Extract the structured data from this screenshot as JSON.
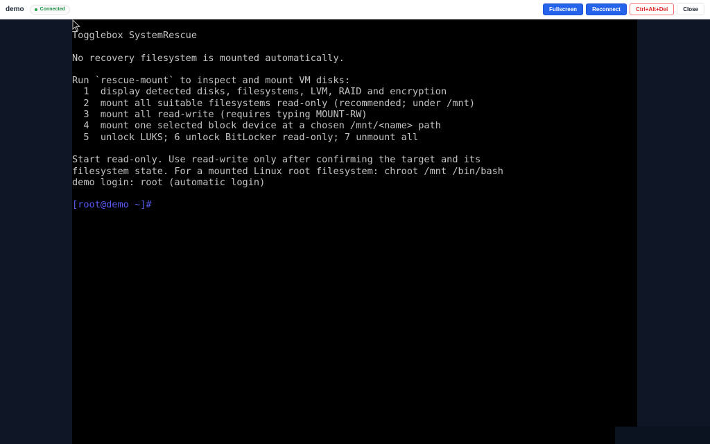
{
  "header": {
    "vm_name": "demo",
    "status": "Connected",
    "buttons": {
      "fullscreen": "Fullscreen",
      "reconnect": "Reconnect",
      "ctrl_alt_del": "Ctrl+Alt+Del",
      "close": "Close"
    }
  },
  "console": {
    "lines": [
      "Togglebox SystemRescue",
      "",
      "No recovery filesystem is mounted automatically.",
      "",
      "Run `rescue-mount` to inspect and mount VM disks:",
      "  1  display detected disks, filesystems, LVM, RAID and encryption",
      "  2  mount all suitable filesystems read-only (recommended; under /mnt)",
      "  3  mount all read-write (requires typing MOUNT-RW)",
      "  4  mount one selected block device at a chosen /mnt/<name> path",
      "  5  unlock LUKS; 6 unlock BitLocker read-only; 7 unmount all",
      "",
      "Start read-only. Use read-write only after confirming the target and its",
      "filesystem state. For a mounted Linux root filesystem: chroot /mnt /bin/bash",
      "demo login: root (automatic login)",
      ""
    ],
    "prompt": "[root@demo ~]#"
  },
  "colors": {
    "accent": "#2563eb",
    "status_ok": "#22a34a",
    "danger": "#dc2626",
    "prompt": "#5a5cf3",
    "console_text": "#c4c4c4"
  },
  "icons": {
    "status": "status-dot-icon",
    "pointer": "mouse-pointer-icon"
  }
}
